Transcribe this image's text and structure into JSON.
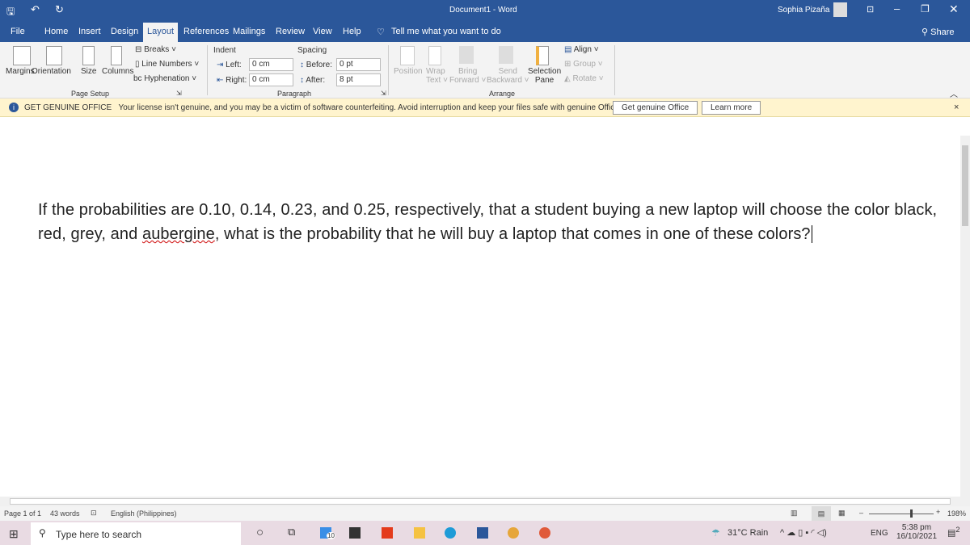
{
  "window": {
    "title": "Document1 - Word",
    "user": "Sophia Pizaña",
    "share": "Share"
  },
  "tabs": [
    "File",
    "Home",
    "Insert",
    "Design",
    "Layout",
    "References",
    "Mailings",
    "Review",
    "View",
    "Help"
  ],
  "tell_me": "Tell me what you want to do",
  "ribbon": {
    "page_setup": {
      "margins": "Margins",
      "orientation": "Orientation",
      "size": "Size",
      "columns": "Columns",
      "breaks": "Breaks",
      "line_numbers": "Line Numbers",
      "hyphenation": "Hyphenation",
      "group": "Page Setup"
    },
    "paragraph": {
      "indent": "Indent",
      "spacing": "Spacing",
      "left_label": "Left:",
      "left_value": "0 cm",
      "right_label": "Right:",
      "right_value": "0 cm",
      "before_label": "Before:",
      "before_value": "0 pt",
      "after_label": "After:",
      "after_value": "8 pt",
      "group": "Paragraph"
    },
    "arrange": {
      "position": "Position",
      "wrap": "Wrap",
      "wrap2": "Text",
      "bring": "Bring",
      "bring2": "Forward",
      "send": "Send",
      "send2": "Backward",
      "selection": "Selection",
      "selection2": "Pane",
      "align": "Align",
      "group_btn": "Group",
      "rotate": "Rotate",
      "group": "Arrange"
    }
  },
  "banner": {
    "title": "GET GENUINE OFFICE",
    "message": "Your license isn't genuine, and you may be a victim of software counterfeiting. Avoid interruption and keep your files safe with genuine Office today.",
    "btn1": "Get genuine Office",
    "btn2": "Learn more"
  },
  "document": {
    "text_before": "If the probabilities are 0.10, 0.14, 0.23, and 0.25, respectively, that a student buying a new laptop will choose the color black, red, grey, and ",
    "misspelled": "aubergine",
    "text_after": ", what is the probability that he will buy a laptop that comes in one of these colors?"
  },
  "status": {
    "page": "Page 1 of 1",
    "words": "43 words",
    "language": "English (Philippines)",
    "zoom": "198%"
  },
  "taskbar": {
    "search": "Type here to search",
    "weather": "31°C  Rain",
    "lang": "ENG",
    "time": "5:38 pm",
    "date": "16/10/2021",
    "mail_badge": "10",
    "notif_badge": "2"
  },
  "colors": {
    "accent": "#2b579a",
    "banner": "#fff4ce"
  }
}
